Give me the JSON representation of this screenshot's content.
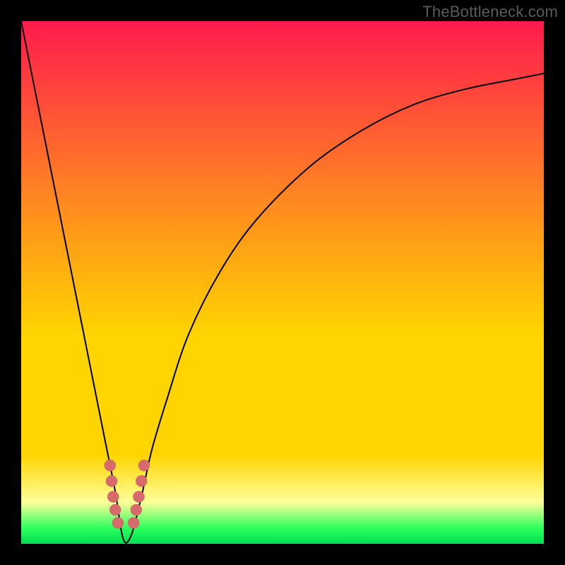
{
  "watermark": "TheBottleneck.com",
  "colors": {
    "top": "#ff1a4d",
    "orange": "#ff8a1f",
    "yellow": "#ffd400",
    "paleyel": "#ffff99",
    "green": "#2dff5e",
    "greenbot": "#00e052",
    "curve": "#000000",
    "marker_fill": "#d76a6a",
    "marker_stroke": "#b85454",
    "bg": "#000000"
  },
  "chart_data": {
    "type": "line",
    "title": "",
    "xlabel": "",
    "ylabel": "",
    "xlim": [
      0,
      100
    ],
    "ylim": [
      0,
      100
    ],
    "series": [
      {
        "name": "bottleneck-curve",
        "x": [
          0,
          2,
          4,
          6,
          8,
          10,
          12,
          14,
          16,
          18,
          19.5,
          21,
          23,
          25,
          28,
          32,
          38,
          45,
          55,
          65,
          75,
          85,
          95,
          100
        ],
        "values": [
          100,
          90,
          80,
          70,
          60,
          50,
          40,
          30,
          20,
          10,
          1,
          1.5,
          9,
          18,
          28,
          40,
          52,
          62,
          72,
          79,
          84,
          87,
          89,
          90
        ]
      }
    ],
    "markers": [
      {
        "x": 17.0,
        "y": 15
      },
      {
        "x": 17.3,
        "y": 12
      },
      {
        "x": 17.6,
        "y": 9
      },
      {
        "x": 18.0,
        "y": 6.5
      },
      {
        "x": 18.5,
        "y": 4
      },
      {
        "x": 21.5,
        "y": 4
      },
      {
        "x": 22.0,
        "y": 6.5
      },
      {
        "x": 22.5,
        "y": 9
      },
      {
        "x": 23.0,
        "y": 12
      },
      {
        "x": 23.5,
        "y": 15
      }
    ],
    "annotations": []
  }
}
